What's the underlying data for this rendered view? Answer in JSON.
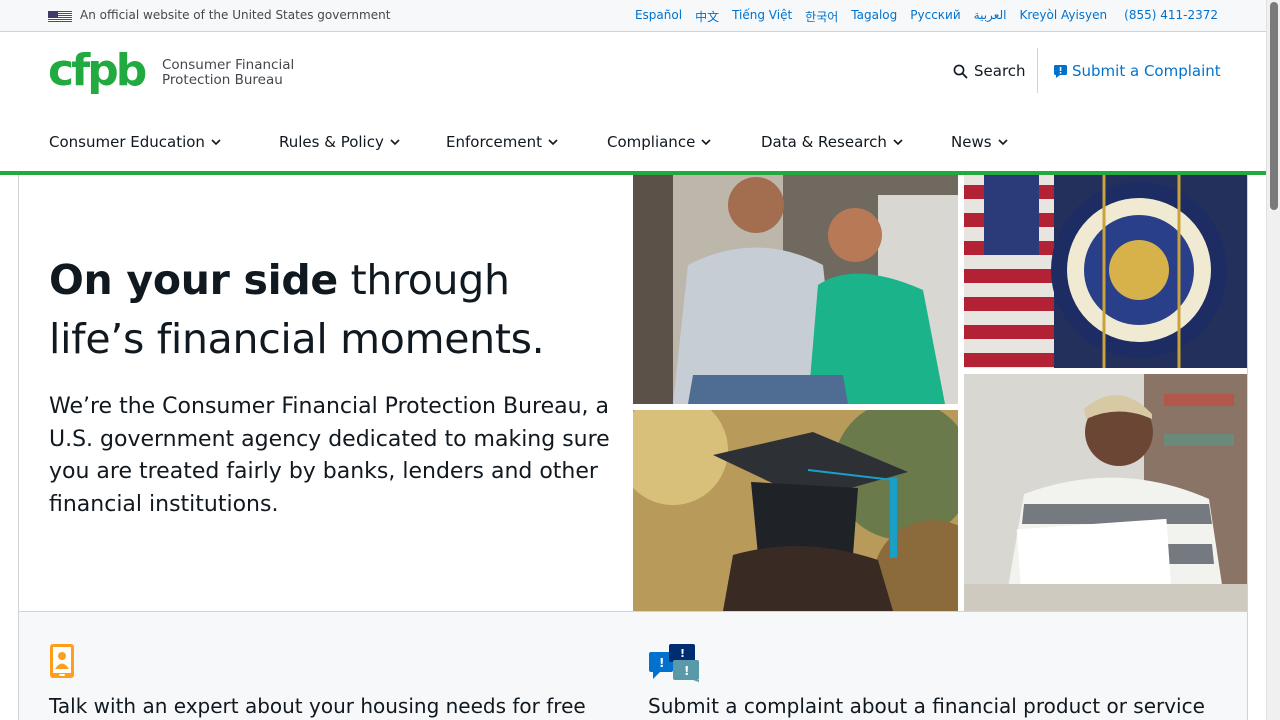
{
  "gov_banner": {
    "text": "An official website of the United States government",
    "languages": [
      "Español",
      "中文",
      "Tiếng Việt",
      "한국어",
      "Tagalog",
      "Русский",
      "العربية",
      "Kreyòl Ayisyen"
    ],
    "phone": "(855) 411-2372"
  },
  "header": {
    "logo_mark": "cfpb",
    "logo_line1": "Consumer Financial",
    "logo_line2": "Protection Bureau",
    "search_label": "Search",
    "complaint_label": "Submit a Complaint"
  },
  "nav": {
    "items": [
      {
        "label": "Consumer Education"
      },
      {
        "label": "Rules & Policy"
      },
      {
        "label": "Enforcement"
      },
      {
        "label": "Compliance"
      },
      {
        "label": "Data & Research"
      },
      {
        "label": "News"
      }
    ]
  },
  "hero": {
    "title_bold": "On your side",
    "title_rest": " through life’s financial moments.",
    "body": "We’re the Consumer Financial Protection Bureau, a U.S. government agency dedicated to making sure you are treated fairly by banks, lenders and other financial institutions.",
    "photos": [
      "couple-photo",
      "flags-seal-photo",
      "graduate-photo",
      "woman-reading-photo"
    ]
  },
  "cards": [
    {
      "text": "Talk with an expert about your housing needs for free",
      "icon": "phone-person-icon"
    },
    {
      "text": "Submit a complaint about a financial product or service",
      "icon": "chat-bubbles-icon"
    }
  ],
  "colors": {
    "brand_green": "#20aa3f",
    "link_blue": "#0072ce",
    "text": "#101820",
    "banner_bg": "#f7f8f9"
  }
}
